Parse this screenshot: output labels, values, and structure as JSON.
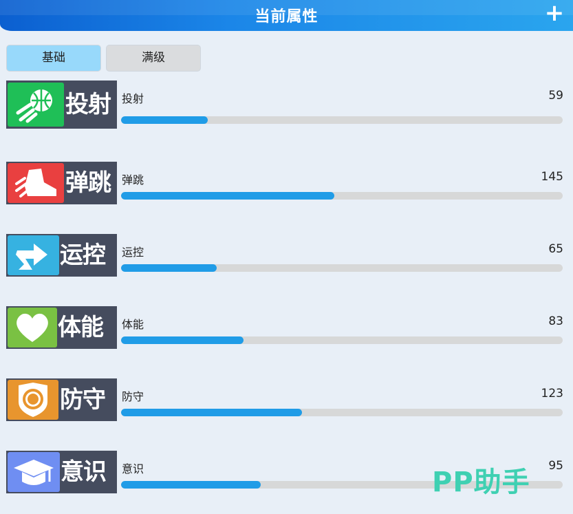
{
  "header": {
    "title": "当前属性",
    "action_icon": "plus-icon"
  },
  "tabs": [
    {
      "label": "基础",
      "active": true
    },
    {
      "label": "满级",
      "active": false
    }
  ],
  "bar_max": 300,
  "stats": [
    {
      "badge": "投射",
      "name": "投射",
      "value": "59",
      "icon": "basketball-icon",
      "icon_color": "#1fbf57"
    },
    {
      "badge": "弹跳",
      "name": "弹跳",
      "value": "145",
      "icon": "sneaker-icon",
      "icon_color": "#e94040"
    },
    {
      "badge": "运控",
      "name": "运控",
      "value": "65",
      "icon": "zigzag-arrow-icon",
      "icon_color": "#36b2e1"
    },
    {
      "badge": "体能",
      "name": "体能",
      "value": "83",
      "icon": "heart-icon",
      "icon_color": "#7ac143"
    },
    {
      "badge": "防守",
      "name": "防守",
      "value": "123",
      "icon": "shield-icon",
      "icon_color": "#e8952e"
    },
    {
      "badge": "意识",
      "name": "意识",
      "value": "95",
      "icon": "graduation-cap-icon",
      "icon_color": "#6f8ef2"
    }
  ],
  "watermark": "PP助手"
}
